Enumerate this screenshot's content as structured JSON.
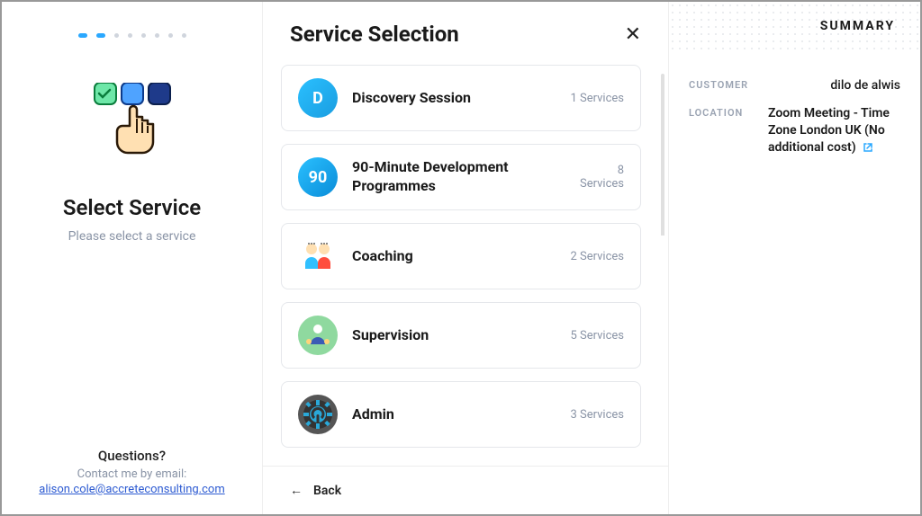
{
  "progress": {
    "total": 8,
    "current": 2
  },
  "left": {
    "title": "Select Service",
    "subtitle": "Please select a service",
    "footer": {
      "question": "Questions?",
      "contact_line": "Contact me by email:",
      "email": "alison.cole@accreteconsulting.com"
    }
  },
  "middle": {
    "title": "Service Selection",
    "services": [
      {
        "icon": "D",
        "icon_kind": "letter-d",
        "name": "Discovery Session",
        "count_text": "1 Services"
      },
      {
        "icon": "90",
        "icon_kind": "number-90",
        "name": "90-Minute Development Programmes",
        "count_text": "8\nServices"
      },
      {
        "icon": "👥",
        "icon_kind": "coaching",
        "name": "Coaching",
        "count_text": "2 Services"
      },
      {
        "icon": "🧑‍💼",
        "icon_kind": "supervision",
        "name": "Supervision",
        "count_text": "5 Services"
      },
      {
        "icon": "⚙",
        "icon_kind": "admin",
        "name": "Admin",
        "count_text": "3 Services"
      }
    ],
    "back_label": "Back"
  },
  "summary": {
    "heading": "SUMMARY",
    "customer_label": "CUSTOMER",
    "customer_value": "dilo de alwis",
    "location_label": "LOCATION",
    "location_value": "Zoom Meeting - Time Zone London UK (No additional cost)"
  }
}
